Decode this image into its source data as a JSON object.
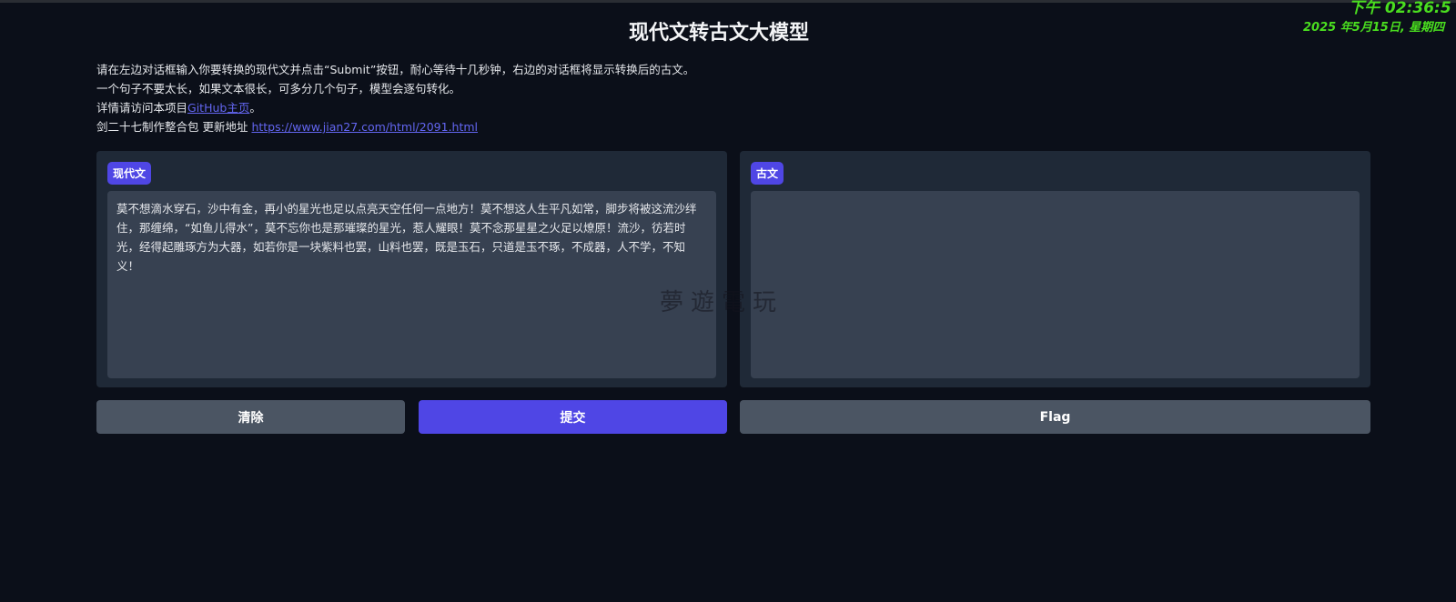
{
  "title": "现代文转古文大模型",
  "clock": {
    "time": "下午 02:36:5",
    "date": "2025 年5月15日, 星期四"
  },
  "description": {
    "line1": "请在左边对话框输入你要转换的现代文并点击“Submit”按钮，耐心等待十几秒钟，右边的对话框将显示转换后的古文。",
    "line2": "一个句子不要太长，如果文本很长，可多分几个句子，模型会逐句转化。",
    "line3_prefix": "详情请访问本项目",
    "line3_link": "GitHub主页",
    "line3_suffix": "。",
    "line4_prefix": "剑二十七制作整合包 更新地址 ",
    "line4_link": "https://www.jian27.com/html/2091.html"
  },
  "input": {
    "label": "现代文",
    "value": "莫不想滴水穿石，沙中有金，再小的星光也足以点亮天空任何一点地方！莫不想这人生平凡如常，脚步将被这流沙绊住，那缠绵，“如鱼儿得水”，莫不忘你也是那璀璨的星光，惹人耀眼！莫不念那星星之火足以燎原！流沙，彷若时光，经得起雕琢方为大器，如若你是一块紫料也罢，山料也罢，既是玉石，只道是玉不琢，不成器，人不学，不知义！"
  },
  "output": {
    "label": "古文",
    "value": ""
  },
  "watermark": "夢遊電玩",
  "buttons": {
    "clear": "清除",
    "submit": "提交",
    "flag": "Flag"
  }
}
